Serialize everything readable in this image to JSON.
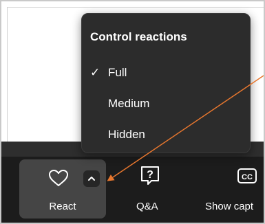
{
  "menu": {
    "title": "Control reactions",
    "items": [
      {
        "label": "Full",
        "selected": true,
        "check": "✓"
      },
      {
        "label": "Medium",
        "selected": false
      },
      {
        "label": "Hidden",
        "selected": false
      }
    ]
  },
  "toolbar": {
    "react_label": "React",
    "qa_label": "Q&A",
    "captions_label": "Show capt",
    "cc_text": "CC"
  },
  "colors": {
    "annotation_arrow": "#e8772e",
    "toolbar_bg": "#1c1c1c",
    "menu_bg": "#2c2c2c",
    "react_button_bg": "#454545"
  }
}
